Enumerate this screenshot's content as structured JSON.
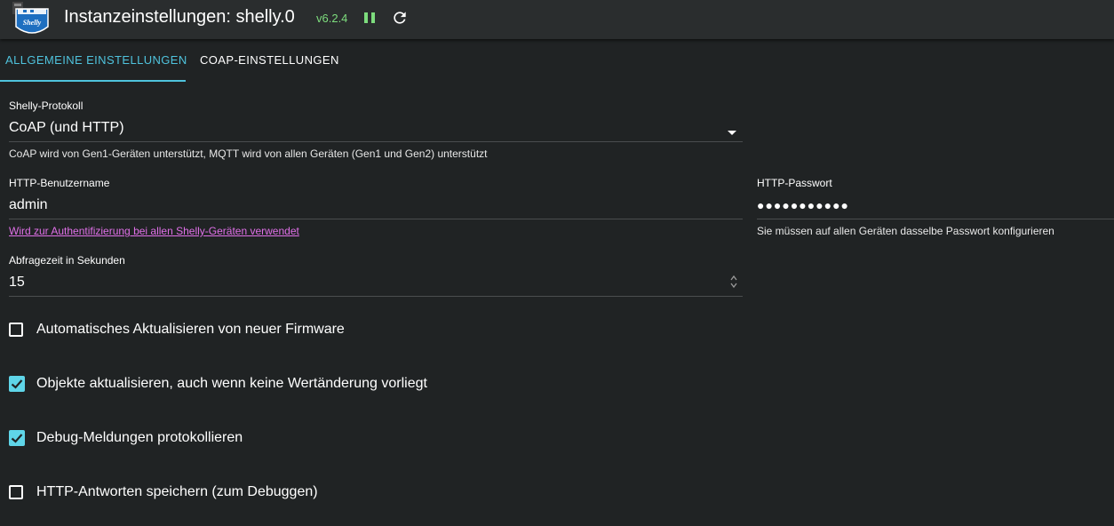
{
  "header": {
    "title": "Instanzeinstellungen: shelly.0",
    "version": "v6.2.4",
    "logo_text": "Shelly",
    "logo_icon": "shelly-logo-icon",
    "pause_icon": "pause-icon",
    "reload_icon": "reload-icon",
    "version_color": "#7ddc7d",
    "pause_color": "#7ddc7d"
  },
  "tabs": [
    {
      "label": "Allgemeine Einstellungen",
      "active": true
    },
    {
      "label": "CoAP-Einstellungen",
      "active": false
    }
  ],
  "form": {
    "protocol": {
      "label": "Shelly-Protokoll",
      "value": "CoAP (und HTTP)",
      "helper": "CoAP wird von Gen1-Geräten unterstützt, MQTT wird von allen Geräten (Gen1 und Gen2) unterstützt"
    },
    "username": {
      "label": "HTTP-Benutzername",
      "value": "admin",
      "helper": "Wird zur Authentifizierung bei allen Shelly-Geräten verwendet"
    },
    "password": {
      "label": "HTTP-Passwort",
      "value": "●●●●●●●●●●●",
      "helper": "Sie müssen auf allen Geräten dasselbe Passwort konfigurieren"
    },
    "poll_interval": {
      "label": "Abfragezeit in Sekunden",
      "value": "15"
    },
    "checkboxes": [
      {
        "label": "Automatisches Aktualisieren von neuer Firmware",
        "checked": false
      },
      {
        "label": "Objekte aktualisieren, auch wenn keine Wertänderung vorliegt",
        "checked": true
      },
      {
        "label": "Debug-Meldungen protokollieren",
        "checked": true
      },
      {
        "label": "HTTP-Antworten speichern (zum Debuggen)",
        "checked": false
      }
    ]
  },
  "colors": {
    "background": "#202324",
    "accent": "#4fc3dd",
    "checkbox_checked": "#5fd5e8",
    "link": "#e070e8"
  }
}
